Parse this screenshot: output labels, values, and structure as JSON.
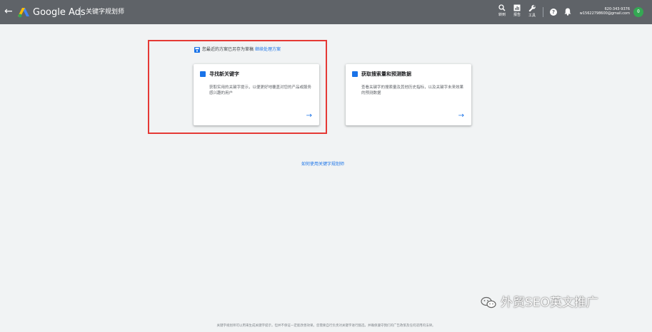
{
  "topbar": {
    "back_glyph": "←",
    "brand": "Google Ads",
    "tool_title": "关键字规划师",
    "buttons": [
      {
        "label": "转到",
        "icon": "search-icon"
      },
      {
        "label": "报告",
        "icon": "reports-icon"
      },
      {
        "label": "工具",
        "icon": "wrench-icon"
      }
    ],
    "help_glyph": "?",
    "account_id": "620-343-9376",
    "account_email": "w15622798600@gmail.com",
    "avatar_initial": "θ"
  },
  "main": {
    "draft_notice": "您最近的方案已另存为草稿",
    "draft_link": "继续处理方案",
    "cards": [
      {
        "title": "寻找新关键字",
        "description": "获取实用的关键字提示，以便更好地覆盖对您的产品或服务感兴趣的用户",
        "arrow": "→",
        "icon": "search-icon"
      },
      {
        "title": "获取搜索量和预测数据",
        "description": "查看关键字的搜索量及其他历史指标，以及关键字未来效果的预测数据",
        "arrow": "→",
        "icon": "bar-chart-icon"
      }
    ],
    "howto_link": "如何使用关键字规划师"
  },
  "watermark": "外贸SEO英文推广",
  "footer": "关键字规划师可以用来生成关键字提示，但并不保证一定能改善效果。您需要自行负责对关键字进行甄选，并确保遵守我们的广告政策及任何适用的法律。",
  "colors": {
    "topbar": "#5f6368",
    "accent": "#1a73e8",
    "highlight": "#e53935",
    "avatar": "#34a853"
  }
}
